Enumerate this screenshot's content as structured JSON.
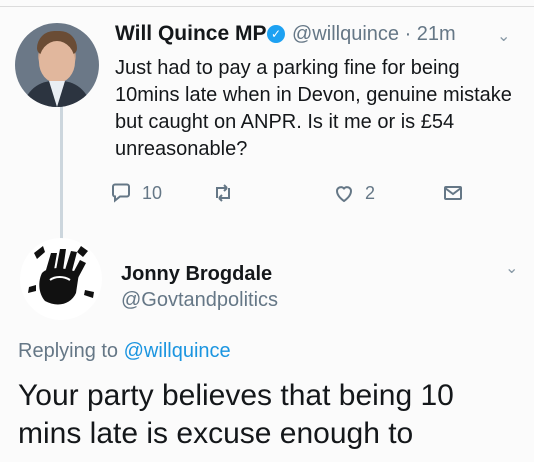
{
  "tweet": {
    "author_name": "Will Quince MP",
    "verified_icon": "✓",
    "handle_time": "@willquince · 21m",
    "text": "Just had to pay a parking fine for being 10mins late when in Devon, genuine mistake but caught on ANPR. Is it me or is £54 unreasonable?",
    "actions": {
      "replies": "10",
      "retweets": "",
      "likes": "2"
    }
  },
  "reply": {
    "author_name": "Jonny Brogdale",
    "handle": "@Govtandpolitics",
    "replying_prefix": "Replying to ",
    "replying_to": "@willquince",
    "text": "Your party believes that being 10 mins late is excuse enough to"
  },
  "colors": {
    "verified": "#1da1f2",
    "muted": "#657786",
    "link": "#1b95e0"
  }
}
